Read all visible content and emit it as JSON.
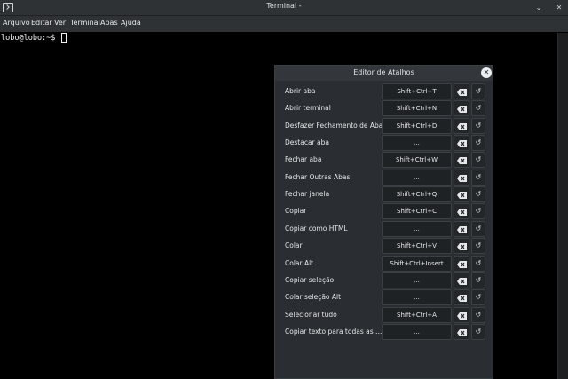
{
  "window": {
    "title": "Terminal -"
  },
  "menubar": {
    "items": [
      "Arquivo",
      "Editar",
      "Ver",
      "Terminal",
      "Abas",
      "Ajuda"
    ]
  },
  "terminal": {
    "prompt": "lobo@lobo:~$ "
  },
  "dialog": {
    "title": "Editor de Atalhos",
    "rows": [
      {
        "label": "Abrir aba",
        "shortcut": "Shift+Ctrl+T"
      },
      {
        "label": "Abrir terminal",
        "shortcut": "Shift+Ctrl+N"
      },
      {
        "label": "Desfazer Fechamento de Aba",
        "shortcut": "Shift+Ctrl+D"
      },
      {
        "label": "Destacar aba",
        "shortcut": "..."
      },
      {
        "label": "Fechar aba",
        "shortcut": "Shift+Ctrl+W"
      },
      {
        "label": "Fechar Outras Abas",
        "shortcut": "..."
      },
      {
        "label": "Fechar janela",
        "shortcut": "Shift+Ctrl+Q"
      },
      {
        "label": "Copiar",
        "shortcut": "Shift+Ctrl+C"
      },
      {
        "label": "Copiar como HTML",
        "shortcut": "..."
      },
      {
        "label": "Colar",
        "shortcut": "Shift+Ctrl+V"
      },
      {
        "label": "Colar Alt",
        "shortcut": "Shift+Ctrl+Insert"
      },
      {
        "label": "Copiar seleção",
        "shortcut": "..."
      },
      {
        "label": "Colar seleção Alt",
        "shortcut": "..."
      },
      {
        "label": "Selecionar tudo",
        "shortcut": "Shift+Ctrl+A"
      },
      {
        "label": "Copiar texto para todas as ab...",
        "shortcut": "..."
      }
    ]
  },
  "icons": {
    "app": "terminal-icon",
    "clear": "backspace-clear-icon",
    "reset": "undo-reset-icon",
    "close": "close-icon"
  }
}
